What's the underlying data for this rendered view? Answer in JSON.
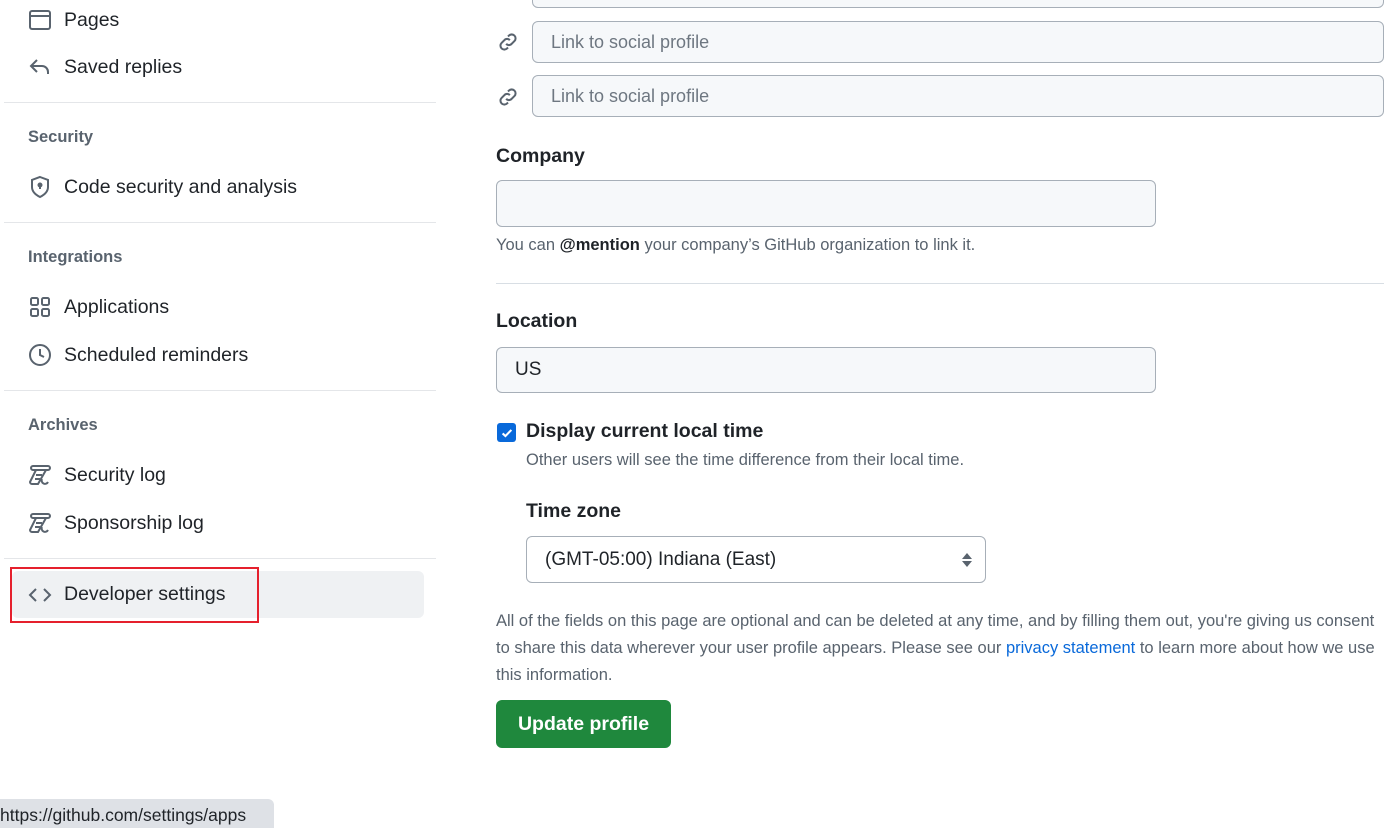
{
  "sidebar": {
    "items_top": [
      {
        "label": "Pages",
        "icon": "browser-icon"
      },
      {
        "label": "Saved replies",
        "icon": "reply-icon"
      }
    ],
    "sections": [
      {
        "heading": "Security",
        "items": [
          {
            "label": "Code security and analysis",
            "icon": "shield-lock-icon"
          }
        ]
      },
      {
        "heading": "Integrations",
        "items": [
          {
            "label": "Applications",
            "icon": "apps-icon"
          },
          {
            "label": "Scheduled reminders",
            "icon": "clock-icon"
          }
        ]
      },
      {
        "heading": "Archives",
        "items": [
          {
            "label": "Security log",
            "icon": "log-icon"
          },
          {
            "label": "Sponsorship log",
            "icon": "log-icon"
          }
        ]
      }
    ],
    "developer_settings": {
      "label": "Developer settings",
      "icon": "code-icon",
      "highlight_color": "#e5202d"
    }
  },
  "main": {
    "social_placeholder": "Link to social profile",
    "company": {
      "label": "Company",
      "value": "",
      "note_prefix": "You can ",
      "note_bold": "@mention",
      "note_suffix": " your company’s GitHub organization to link it."
    },
    "location": {
      "label": "Location",
      "value": "US"
    },
    "local_time": {
      "label": "Display current local time",
      "checked": true,
      "note": "Other users will see the time difference from their local time."
    },
    "timezone": {
      "label": "Time zone",
      "value": "(GMT-05:00) Indiana (East)"
    },
    "disclaimer": {
      "before": "All of the fields on this page are optional and can be deleted at any time, and by filling them out, you're giving us consent to share this data wherever your user profile appears. Please see our ",
      "link": "privacy statement",
      "after": " to learn more about how we use this information."
    },
    "update_button": "Update profile",
    "colors": {
      "primary": "#1f883d",
      "link": "#0969da",
      "checkbox": "#0969da"
    }
  },
  "status_bar": {
    "url": "https://github.com/settings/apps"
  }
}
